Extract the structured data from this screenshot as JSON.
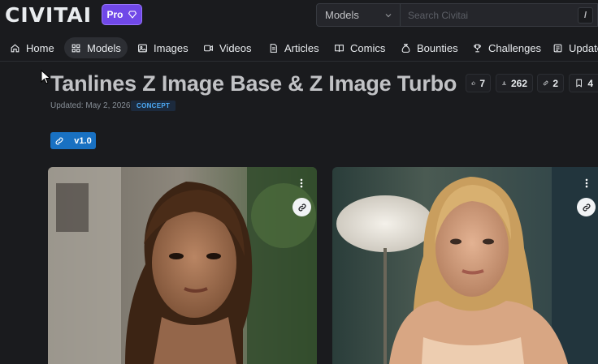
{
  "header": {
    "logo_text": "CIVITAI",
    "pro_label": "Pro",
    "search_scope": "Models",
    "search_placeholder": "Search Civitai",
    "shortcut_key": "/"
  },
  "nav": {
    "items": [
      {
        "label": "Home",
        "icon": "home-icon"
      },
      {
        "label": "Models",
        "icon": "grid-icon",
        "active": true
      },
      {
        "label": "Images",
        "icon": "photo-icon"
      },
      {
        "label": "Videos",
        "icon": "video-icon"
      },
      {
        "label": "Articles",
        "icon": "article-icon"
      },
      {
        "label": "Comics",
        "icon": "book-icon"
      },
      {
        "label": "Bounties",
        "icon": "moneybag-icon"
      },
      {
        "label": "Challenges",
        "icon": "trophy-icon"
      },
      {
        "label": "Update",
        "icon": "news-icon"
      }
    ]
  },
  "model": {
    "title": "Tanlines Z Image Base & Z Image Turbo",
    "updated": "Updated: May 2, 2026",
    "type_badge": "CONCEPT",
    "stats": {
      "likes": "7",
      "downloads": "262",
      "links": "2",
      "bookmarks": "4"
    },
    "version_label": "v1.0"
  },
  "colors": {
    "background": "#1a1b1e",
    "pro_purple": "#7048e8",
    "version_blue": "#1971c2",
    "concept_blue": "#4dabf7"
  }
}
